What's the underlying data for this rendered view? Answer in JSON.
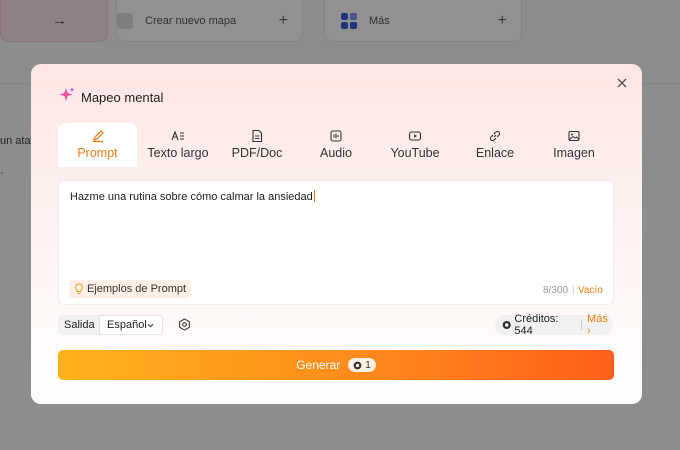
{
  "background": {
    "create_card_label": "Crear nuevo mapa",
    "more_card_label": "Más",
    "side_text": "un ata"
  },
  "modal": {
    "title": "Mapeo mental",
    "tabs": [
      {
        "label": "Prompt",
        "icon": "pen-icon"
      },
      {
        "label": "Texto largo",
        "icon": "long-text-icon"
      },
      {
        "label": "PDF/Doc",
        "icon": "document-icon"
      },
      {
        "label": "Audio",
        "icon": "audio-icon"
      },
      {
        "label": "YouTube",
        "icon": "youtube-icon"
      },
      {
        "label": "Enlace",
        "icon": "link-icon"
      },
      {
        "label": "Imagen",
        "icon": "image-icon"
      }
    ],
    "active_tab": "Prompt",
    "prompt_value": "Hazme una rutina sobre cómo calmar la ansiedad",
    "examples_label": "Ejemplos de Prompt",
    "char_counter": "8/300",
    "clear_label": "Vacío",
    "output_label": "Salida",
    "language_selected": "Español",
    "credits_label": "Créditos: 544",
    "credits_more": "Más",
    "generate_label": "Generar",
    "generate_cost": "1"
  },
  "colors": {
    "accent": "#f07a10",
    "generate_start": "#fdb31d",
    "generate_end": "#ff5f1a"
  }
}
